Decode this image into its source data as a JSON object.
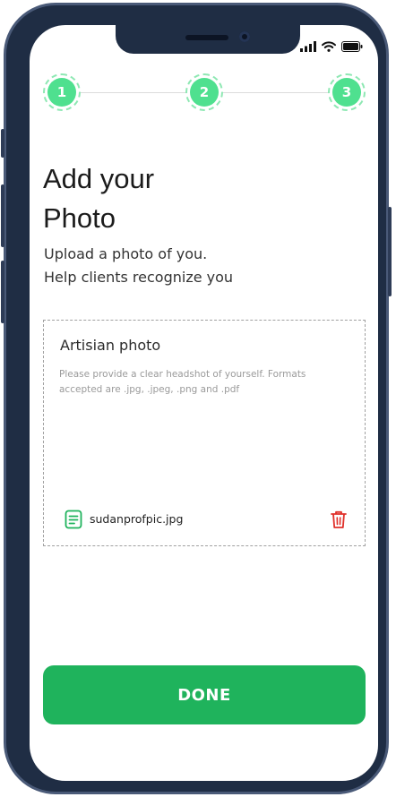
{
  "steps": [
    {
      "number": "1"
    },
    {
      "number": "2"
    },
    {
      "number": "3"
    }
  ],
  "page": {
    "title_line1": "Add your",
    "title_line2": "Photo",
    "subtitle_line1": "Upload a photo of you.",
    "subtitle_line2": "Help clients recognize you"
  },
  "upload": {
    "label": "Artisian photo",
    "help_text": "Please provide a clear headshot of yourself. Formats accepted are .jpg, .jpeg, .png and .pdf",
    "file_name": "sudanprofpic.jpg",
    "file_icon": "document-icon",
    "delete_icon": "trash-icon"
  },
  "actions": {
    "done_label": "DONE"
  },
  "colors": {
    "accent": "#1fb35c",
    "step_fill": "#4fe08f",
    "delete": "#e0302a",
    "frame": "#1f2d44"
  }
}
